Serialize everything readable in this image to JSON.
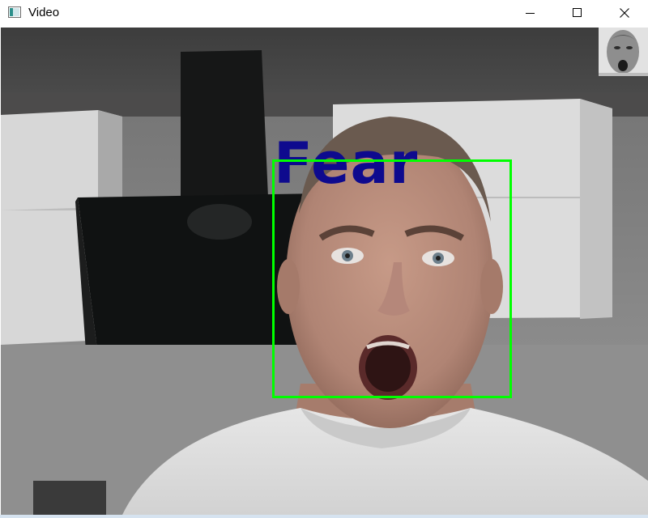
{
  "window": {
    "title": "Video",
    "controls": {
      "minimize": "minimize-icon",
      "maximize": "maximize-icon",
      "close": "close-icon"
    }
  },
  "detection": {
    "label": "Fear",
    "label_color": "#0e0a8e",
    "box_color": "#00ff00"
  }
}
